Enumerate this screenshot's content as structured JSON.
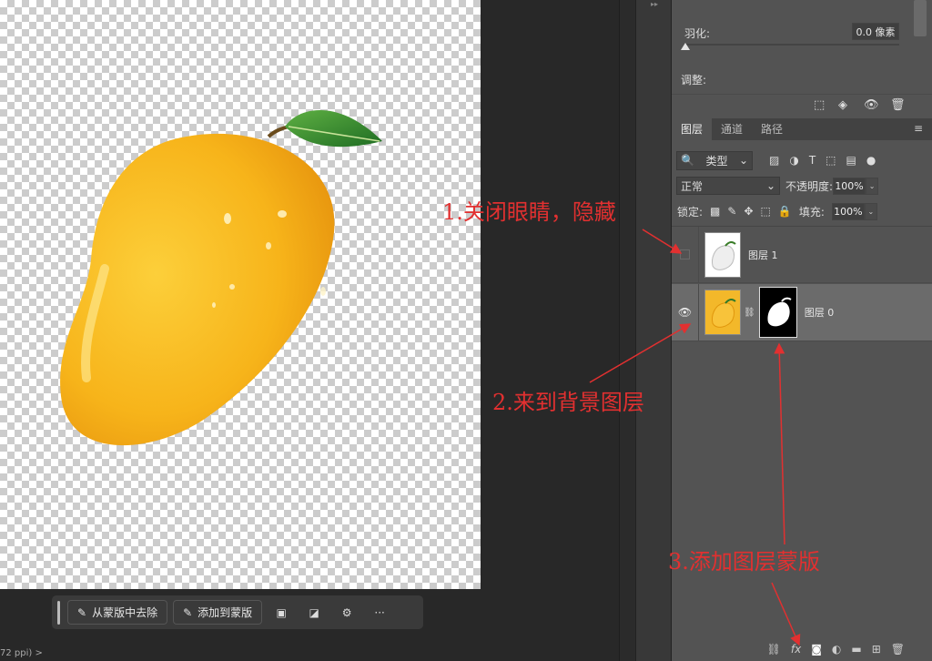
{
  "canvas": {
    "status_text": "72 ppi)  >"
  },
  "mask_taskbar": {
    "subtract_label": "从蒙版中去除",
    "add_label": "添加到蒙版",
    "more_label": "···"
  },
  "properties": {
    "feather_label": "羽化:",
    "feather_value": "0.0 像素",
    "feather_level": 0,
    "adjust_label": "调整:"
  },
  "layers_panel": {
    "tabs": [
      {
        "label": "图层",
        "active": true
      },
      {
        "label": "通道",
        "active": false
      },
      {
        "label": "路径",
        "active": false
      }
    ],
    "filter_type": "类型",
    "blend_mode": "正常",
    "opacity_label": "不透明度:",
    "opacity_value": "100%",
    "lock_label": "锁定:",
    "fill_label": "填充:",
    "fill_value": "100%",
    "layers": [
      {
        "name": "图层 1",
        "visible": false
      },
      {
        "name": "图层 0",
        "visible": true,
        "has_mask": true,
        "selected": true
      }
    ]
  },
  "annotations": {
    "step1": "1.关闭眼睛，隐藏",
    "step2": "2.来到背景图层",
    "step3": "3.添加图层蒙版"
  },
  "colors": {
    "annotation_red": "#e23030",
    "mango_yellow": "#f5b71c",
    "panel_bg": "#535353"
  }
}
